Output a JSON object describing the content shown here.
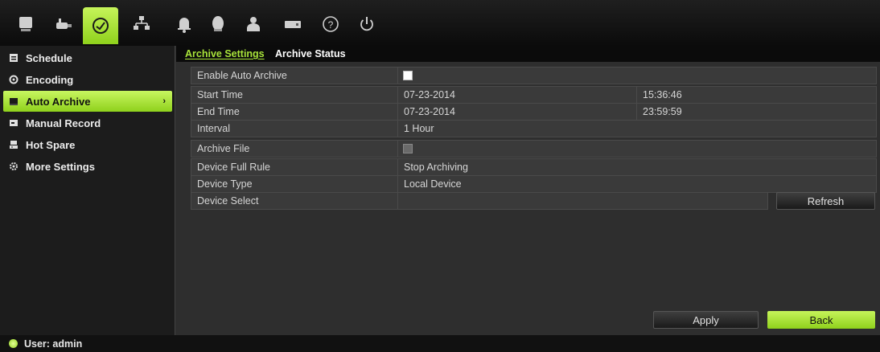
{
  "toolbar": {
    "icons": [
      {
        "name": "display-icon"
      },
      {
        "name": "camera-icon"
      },
      {
        "name": "recording-icon",
        "active": true
      },
      {
        "name": "network-icon"
      },
      {
        "name": "alarm-bell-icon"
      },
      {
        "name": "device-icon"
      },
      {
        "name": "user-icon"
      },
      {
        "name": "system-icon"
      },
      {
        "name": "help-icon"
      },
      {
        "name": "power-icon"
      }
    ]
  },
  "sidebar": {
    "items": [
      {
        "label": "Schedule",
        "icon": "schedule-icon"
      },
      {
        "label": "Encoding",
        "icon": "encoding-icon"
      },
      {
        "label": "Auto Archive",
        "icon": "archive-icon",
        "active": true,
        "arrow": "›"
      },
      {
        "label": "Manual Record",
        "icon": "manual-record-icon"
      },
      {
        "label": "Hot Spare",
        "icon": "hot-spare-icon"
      },
      {
        "label": "More Settings",
        "icon": "more-settings-icon"
      }
    ]
  },
  "tabs": {
    "archive_settings": "Archive Settings",
    "archive_status": "Archive Status"
  },
  "form": {
    "enable_auto_archive": {
      "label": "Enable Auto Archive",
      "checked": true
    },
    "start_time": {
      "label": "Start Time",
      "date": "07-23-2014",
      "time": "15:36:46"
    },
    "end_time": {
      "label": "End Time",
      "date": "07-23-2014",
      "time": "23:59:59"
    },
    "interval": {
      "label": "Interval",
      "value": "1 Hour"
    },
    "archive_file": {
      "label": "Archive File",
      "checked": false
    },
    "device_full_rule": {
      "label": "Device Full Rule",
      "value": "Stop Archiving"
    },
    "device_type": {
      "label": "Device Type",
      "value": "Local Device"
    },
    "device_select": {
      "label": "Device Select",
      "value": "",
      "refresh_label": "Refresh"
    }
  },
  "actions": {
    "apply": "Apply",
    "back": "Back"
  },
  "status": {
    "user": "User: admin"
  },
  "colors": {
    "accent": "#a9e53a",
    "background": "#2e2e2e"
  }
}
